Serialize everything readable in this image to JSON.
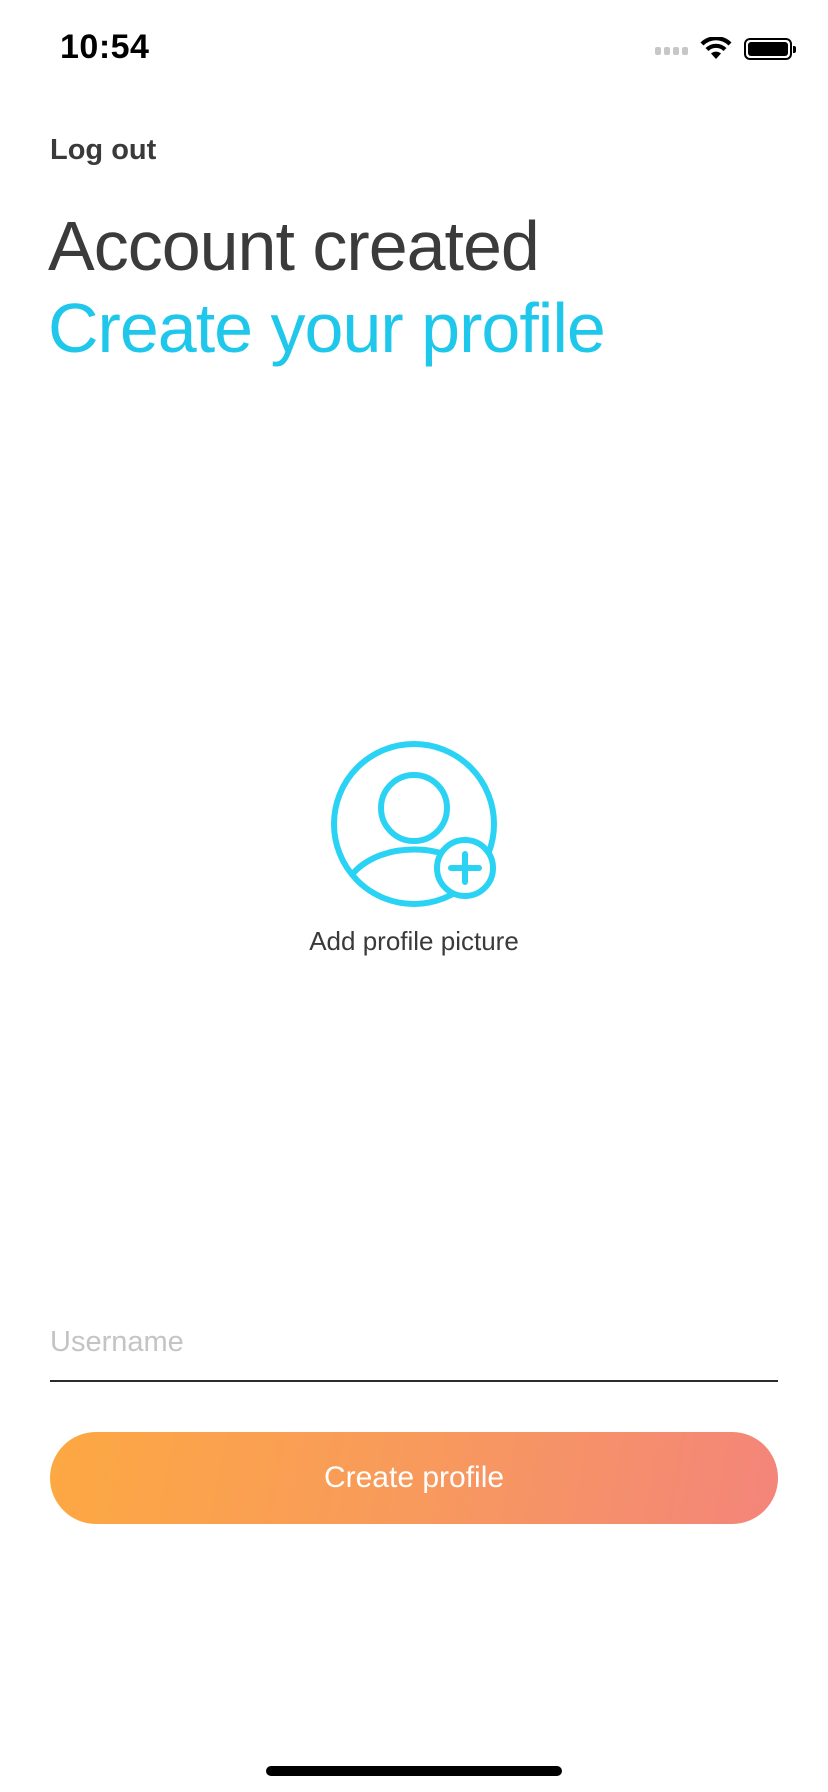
{
  "status_bar": {
    "time": "10:54"
  },
  "header": {
    "logout_label": "Log out",
    "title": "Account created",
    "subtitle": "Create your profile"
  },
  "profile_picture": {
    "icon": "add-profile-picture-icon",
    "label": "Add profile picture"
  },
  "form": {
    "username_placeholder": "Username",
    "username_value": "",
    "submit_label": "Create profile"
  },
  "colors": {
    "accent": "#1fc7ea",
    "button_gradient_start": "#fca842",
    "button_gradient_end": "#f3857a",
    "title_text": "#3b3b3b"
  }
}
